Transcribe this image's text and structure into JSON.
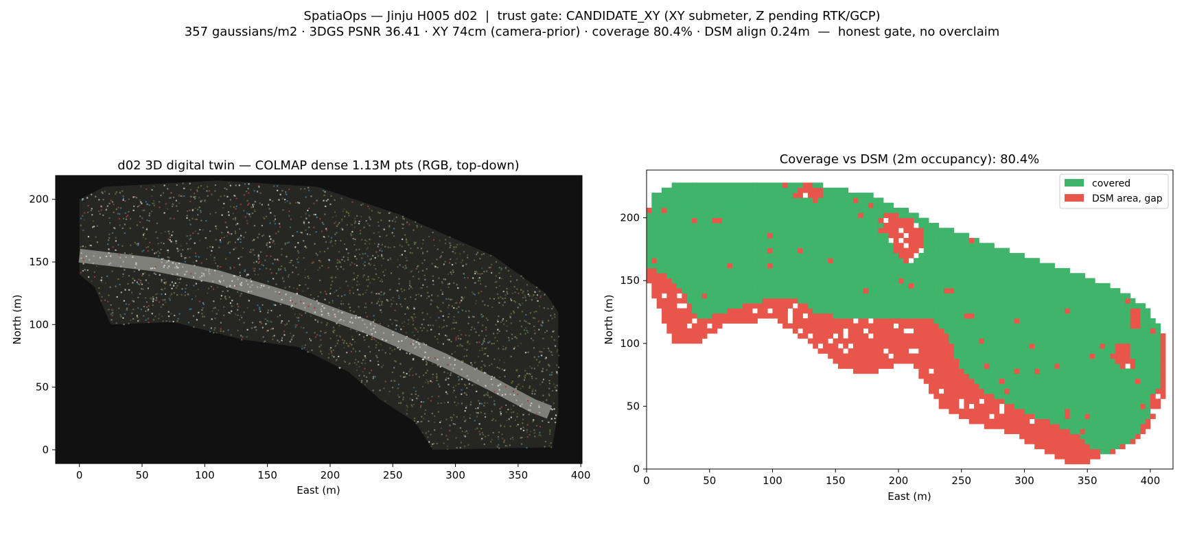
{
  "figure": {
    "title_line1": "SpatiaOps — Jinju H005 d02  |  trust gate: CANDIDATE_XY (XY submeter, Z pending RTK/GCP)",
    "title_line2": "357 gaussians/m2 · 3DGS PSNR 36.41 · XY 74cm (camera-prior) · coverage 80.4% · DSM align 0.24m  —  honest gate, no overclaim"
  },
  "chart_data": [
    {
      "type": "scatter",
      "title": "d02 3D digital twin — COLMAP dense 1.13M pts (RGB, top-down)",
      "xlabel": "East (m)",
      "ylabel": "North (m)",
      "xlim": [
        -19,
        401
      ],
      "ylim": [
        -11,
        219
      ],
      "xticks": [
        0,
        50,
        100,
        150,
        200,
        250,
        300,
        350,
        400
      ],
      "yticks": [
        0,
        50,
        100,
        150,
        200
      ],
      "background": "#111111",
      "grid": false,
      "footprint": [
        [
          0,
          200
        ],
        [
          20,
          210
        ],
        [
          110,
          215
        ],
        [
          190,
          210
        ],
        [
          255,
          188
        ],
        [
          330,
          155
        ],
        [
          372,
          125
        ],
        [
          382,
          110
        ],
        [
          382,
          30
        ],
        [
          377,
          2
        ],
        [
          282,
          0
        ],
        [
          268,
          22
        ],
        [
          240,
          40
        ],
        [
          215,
          62
        ],
        [
          175,
          82
        ],
        [
          130,
          88
        ],
        [
          75,
          102
        ],
        [
          25,
          100
        ],
        [
          12,
          130
        ],
        [
          0,
          140
        ]
      ],
      "road_centerline": [
        [
          0,
          155
        ],
        [
          60,
          148
        ],
        [
          110,
          138
        ],
        [
          170,
          120
        ],
        [
          230,
          98
        ],
        [
          290,
          72
        ],
        [
          330,
          52
        ],
        [
          362,
          35
        ],
        [
          375,
          30
        ]
      ],
      "point_colors": [
        "#7a7a72",
        "#9a9a90",
        "#5e5a50",
        "#4f5a3a",
        "#3e4a2a",
        "#6d6a5a",
        "#b8b8b0",
        "#2e6e8a",
        "#8a3a3a",
        "#556b2f"
      ]
    },
    {
      "type": "heatmap",
      "title": "Coverage vs DSM (2m occupancy): 80.4%",
      "xlabel": "East (m)",
      "ylabel": "North (m)",
      "xlim": [
        0,
        418
      ],
      "ylim": [
        0,
        238
      ],
      "xticks": [
        0,
        50,
        100,
        150,
        200,
        250,
        300,
        350,
        400
      ],
      "yticks": [
        0,
        50,
        100,
        150,
        200
      ],
      "cell_size": 2,
      "coverage_percent": 80.4,
      "legend_position": "upper right",
      "legend": [
        {
          "label": "covered",
          "color": "#3fb46a"
        },
        {
          "label": "DSM area, gap",
          "color": "#e8564b"
        }
      ],
      "dsm_extent": [
        [
          5,
          218
        ],
        [
          22,
          228
        ],
        [
          60,
          230
        ],
        [
          100,
          230
        ],
        [
          140,
          226
        ],
        [
          180,
          218
        ],
        [
          230,
          195
        ],
        [
          285,
          175
        ],
        [
          345,
          155
        ],
        [
          385,
          138
        ],
        [
          400,
          125
        ],
        [
          410,
          110
        ],
        [
          412,
          92
        ],
        [
          412,
          62
        ],
        [
          405,
          42
        ],
        [
          390,
          22
        ],
        [
          362,
          10
        ],
        [
          342,
          2
        ],
        [
          318,
          12
        ],
        [
          292,
          28
        ],
        [
          262,
          36
        ],
        [
          235,
          48
        ],
        [
          222,
          68
        ],
        [
          210,
          86
        ],
        [
          180,
          74
        ],
        [
          155,
          80
        ],
        [
          130,
          100
        ],
        [
          100,
          120
        ],
        [
          62,
          114
        ],
        [
          36,
          98
        ],
        [
          20,
          102
        ],
        [
          8,
          132
        ],
        [
          0,
          152
        ],
        [
          0,
          200
        ]
      ],
      "covered_region": [
        [
          3,
          215
        ],
        [
          15,
          227
        ],
        [
          60,
          230
        ],
        [
          100,
          230
        ],
        [
          140,
          226
        ],
        [
          180,
          218
        ],
        [
          230,
          195
        ],
        [
          285,
          175
        ],
        [
          345,
          155
        ],
        [
          385,
          138
        ],
        [
          400,
          125
        ],
        [
          410,
          110
        ],
        [
          410,
          92
        ],
        [
          406,
          62
        ],
        [
          398,
          40
        ],
        [
          384,
          22
        ],
        [
          362,
          12
        ],
        [
          340,
          28
        ],
        [
          310,
          42
        ],
        [
          270,
          60
        ],
        [
          250,
          80
        ],
        [
          240,
          105
        ],
        [
          230,
          118
        ],
        [
          198,
          120
        ],
        [
          165,
          118
        ],
        [
          140,
          122
        ],
        [
          115,
          138
        ],
        [
          80,
          132
        ],
        [
          60,
          125
        ],
        [
          50,
          120
        ],
        [
          40,
          122
        ],
        [
          25,
          145
        ],
        [
          0,
          160
        ],
        [
          0,
          180
        ]
      ],
      "gap_regions": [
        [
          [
            0,
            162
          ],
          [
            22,
            150
          ],
          [
            30,
            140
          ],
          [
            36,
            128
          ],
          [
            45,
            118
          ],
          [
            62,
            116
          ],
          [
            90,
            130
          ],
          [
            115,
            136
          ],
          [
            135,
            124
          ],
          [
            160,
            120
          ],
          [
            180,
            120
          ],
          [
            210,
            114
          ],
          [
            232,
            110
          ],
          [
            238,
            100
          ],
          [
            236,
            82
          ],
          [
            230,
            70
          ],
          [
            216,
            62
          ],
          [
            200,
            72
          ],
          [
            185,
            76
          ],
          [
            160,
            82
          ],
          [
            130,
            98
          ],
          [
            100,
            118
          ],
          [
            70,
            110
          ],
          [
            40,
            98
          ],
          [
            20,
            102
          ],
          [
            8,
            132
          ]
        ],
        [
          [
            224,
            62
          ],
          [
            240,
            54
          ],
          [
            262,
            42
          ],
          [
            292,
            34
          ],
          [
            318,
            16
          ],
          [
            340,
            2
          ],
          [
            352,
            4
          ],
          [
            356,
            14
          ],
          [
            336,
            28
          ],
          [
            310,
            38
          ],
          [
            278,
            52
          ],
          [
            250,
            60
          ],
          [
            232,
            70
          ]
        ],
        [
          [
            190,
            205
          ],
          [
            208,
            200
          ],
          [
            220,
            190
          ],
          [
            218,
            172
          ],
          [
            208,
            164
          ],
          [
            198,
            172
          ],
          [
            190,
            188
          ]
        ],
        [
          [
            115,
            218
          ],
          [
            135,
            214
          ],
          [
            142,
            222
          ],
          [
            128,
            228
          ]
        ],
        [
          [
            384,
            126
          ],
          [
            392,
            128
          ],
          [
            394,
            112
          ],
          [
            386,
            110
          ]
        ],
        [
          [
            370,
            102
          ],
          [
            382,
            100
          ],
          [
            388,
            80
          ],
          [
            376,
            78
          ]
        ],
        [
          [
            398,
            60
          ],
          [
            412,
            58
          ],
          [
            412,
            40
          ],
          [
            402,
            42
          ]
        ]
      ]
    }
  ]
}
